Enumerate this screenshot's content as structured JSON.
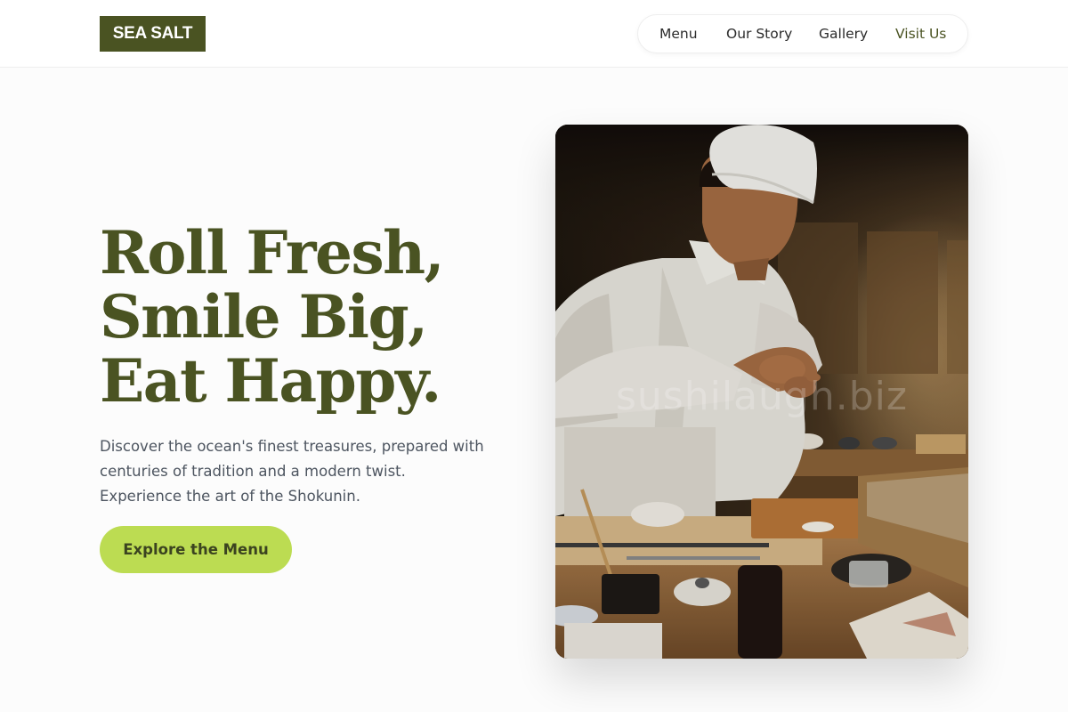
{
  "brand": {
    "name": "SEA SALT",
    "color": "#4a5322"
  },
  "nav": {
    "items": [
      {
        "label": "Menu",
        "active": false
      },
      {
        "label": "Our Story",
        "active": false
      },
      {
        "label": "Gallery",
        "active": false
      },
      {
        "label": "Visit Us",
        "active": true
      }
    ]
  },
  "hero": {
    "headline": [
      "Roll Fresh,",
      "Smile Big,",
      "Eat Happy."
    ],
    "description": [
      "Discover the ocean's finest treasures, prepared with",
      "centuries of tradition and a modern twist.",
      "Experience the art of the Shokunin."
    ],
    "cta_label": "Explore the Menu",
    "cta_color": "#bcdc52"
  },
  "photo": {
    "watermark": "sushilaugh.biz"
  }
}
